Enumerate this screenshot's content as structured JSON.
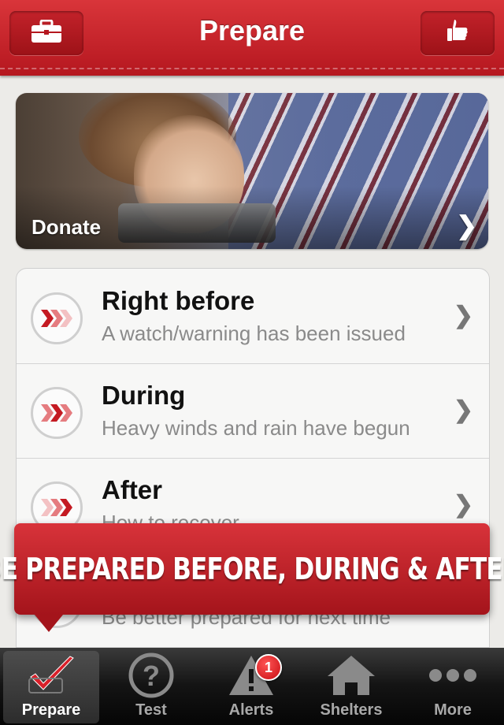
{
  "header": {
    "title": "Prepare",
    "left_icon": "toolbox-icon",
    "right_icon": "thumbs-up-icon"
  },
  "hero": {
    "label": "Donate"
  },
  "list": {
    "items": [
      {
        "title": "Right before",
        "subtitle": "A watch/warning has been issued"
      },
      {
        "title": "During",
        "subtitle": "Heavy winds and rain have begun"
      },
      {
        "title": "After",
        "subtitle": "How to recover"
      },
      {
        "title": "",
        "subtitle": "Be better prepared for next time"
      }
    ]
  },
  "banner": {
    "text": "BE PREPARED BEFORE, DURING & AFTER"
  },
  "tabbar": {
    "tabs": [
      {
        "label": "Prepare",
        "icon": "checkmark-icon",
        "active": true
      },
      {
        "label": "Test",
        "icon": "question-icon"
      },
      {
        "label": "Alerts",
        "icon": "warning-icon",
        "badge": "1"
      },
      {
        "label": "Shelters",
        "icon": "house-icon"
      },
      {
        "label": "More",
        "icon": "more-dots-icon"
      }
    ]
  },
  "colors": {
    "brand_red": "#c8202a",
    "tab_bar": "#141414"
  }
}
